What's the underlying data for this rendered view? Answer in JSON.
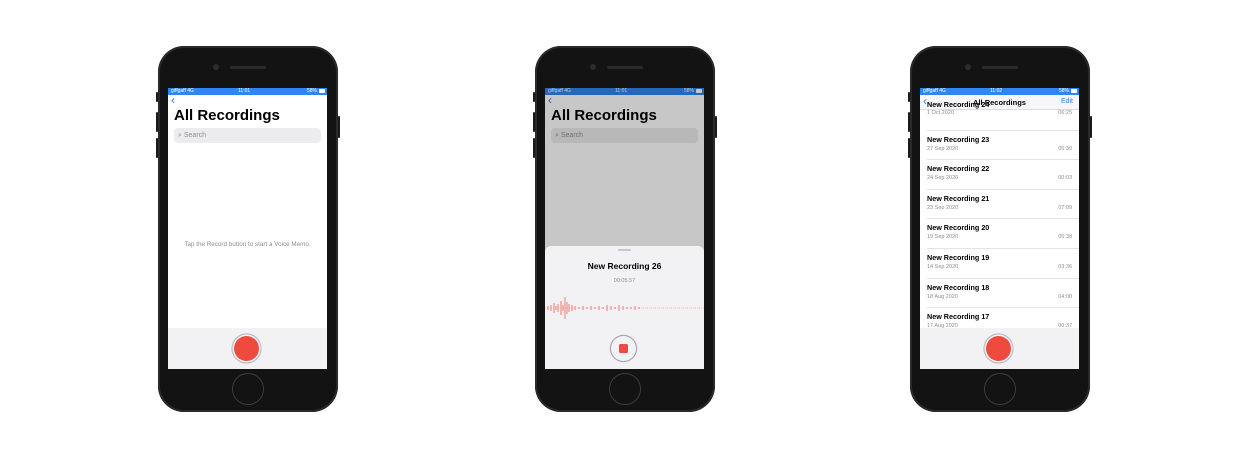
{
  "colors": {
    "accent": "#2f7cf6",
    "record": "#ee4a3e",
    "status_bar": "#2f86f3"
  },
  "status_bar": {
    "carrier": "giffgaff 4G",
    "time_1": "11:01",
    "time_2": "11:01",
    "time_3": "11:02",
    "battery": "58%"
  },
  "screen1": {
    "back_icon": "chevron-left-icon",
    "title": "All Recordings",
    "search_placeholder": "Search",
    "empty_message": "Tap the Record button to start a Voice Memo."
  },
  "screen2": {
    "title": "All Recordings",
    "search_placeholder": "Search",
    "recording_title": "New Recording 26",
    "recording_time": "00:05.57"
  },
  "screen3": {
    "nav_title": "All Recordings",
    "edit_label": "Edit",
    "recordings": [
      {
        "name": "New Recording 24",
        "date": "1 Oct 2020",
        "duration": "06:25"
      },
      {
        "name": "New Recording 23",
        "date": "27 Sep 2020",
        "duration": "05:30"
      },
      {
        "name": "New Recording 22",
        "date": "24 Sep 2020",
        "duration": "00:03"
      },
      {
        "name": "New Recording 21",
        "date": "23 Sep 2020",
        "duration": "07:09"
      },
      {
        "name": "New Recording 20",
        "date": "19 Sep 2020",
        "duration": "05:38"
      },
      {
        "name": "New Recording 19",
        "date": "14 Sep 2020",
        "duration": "03:36"
      },
      {
        "name": "New Recording 18",
        "date": "18 Aug 2020",
        "duration": "04:00"
      },
      {
        "name": "New Recording 17",
        "date": "17 Aug 2020",
        "duration": "00:37"
      }
    ]
  }
}
